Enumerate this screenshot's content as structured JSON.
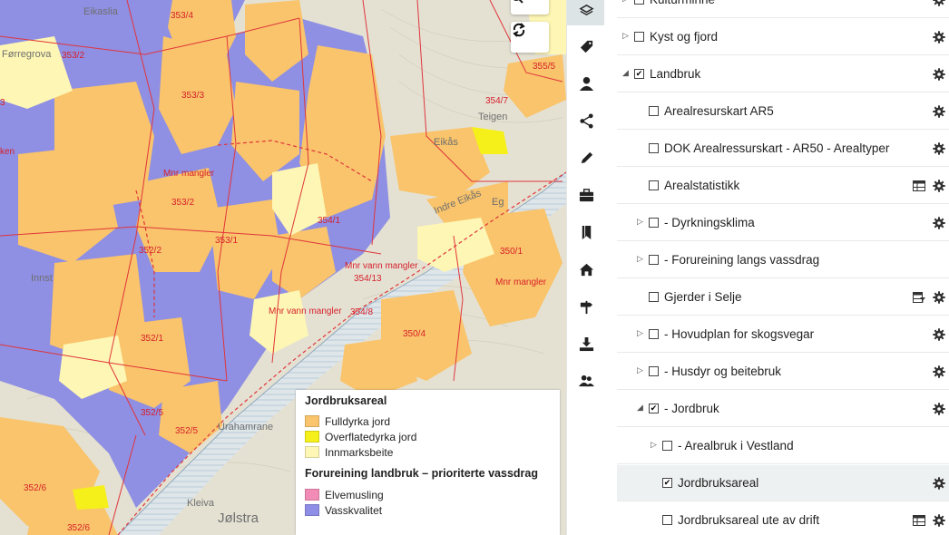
{
  "map": {
    "place_labels": [
      "Eikaslia",
      "Førregrova",
      "Eikås",
      "Teigen",
      "Indre Eikås",
      "Eg",
      "Innst",
      "Urahamrane",
      "Kleiva",
      "Jølstra"
    ],
    "parcel_labels": [
      "353/4",
      "353/2",
      "355/5",
      "354/7",
      "353/3",
      "353/2",
      "354/1",
      "353/1",
      "352/2",
      "350/1",
      "354/13",
      "354/8",
      "350/4",
      "352/1",
      "352/5",
      "352/5",
      "352/6",
      "352/6",
      "3",
      "ken"
    ],
    "mnr_labels": [
      "Mnr mangler",
      "Mnr vann mangler",
      "Mnr mangler",
      "Mnr vann mangler"
    ],
    "legend": {
      "title1": "Jordbruksareal",
      "items1": [
        {
          "label": "Fulldyrka jord",
          "color": "#f9c46b"
        },
        {
          "label": "Overflatedyrka jord",
          "color": "#f6f01a"
        },
        {
          "label": "Innmarksbeite",
          "color": "#fdf6b4"
        }
      ],
      "title2": "Forureining landbruk – prioriterte vassdrag",
      "items2": [
        {
          "label": "Elvemusling",
          "color": "#f28bb5"
        },
        {
          "label": "Vasskvalitet",
          "color": "#8e8ee6"
        }
      ]
    }
  },
  "toolbar": {
    "items": [
      "layers-icon",
      "tag-icon",
      "person-icon",
      "share-icon",
      "pencil-icon",
      "briefcase-icon",
      "bookmark-icon",
      "home-icon",
      "signpost-icon",
      "download-icon",
      "users-icon"
    ]
  },
  "layers": [
    {
      "label": "Kulturminne",
      "checked": false,
      "expander": "closed",
      "level": 0,
      "gear": true,
      "extra": ""
    },
    {
      "label": "Kyst og fjord",
      "checked": false,
      "expander": "closed",
      "level": 0,
      "gear": true,
      "extra": ""
    },
    {
      "label": "Landbruk",
      "checked": true,
      "expander": "open",
      "level": 0,
      "gear": true,
      "extra": ""
    },
    {
      "label": "Arealresurskart AR5",
      "checked": false,
      "expander": "none",
      "level": 1,
      "gear": true,
      "extra": ""
    },
    {
      "label": "DOK Arealressurskart - AR50 - Arealtyper",
      "checked": false,
      "expander": "none",
      "level": 1,
      "gear": true,
      "extra": ""
    },
    {
      "label": "Arealstatistikk",
      "checked": false,
      "expander": "none",
      "level": 1,
      "gear": true,
      "extra": "table"
    },
    {
      "label": "- Dyrkningsklima",
      "checked": false,
      "expander": "closed",
      "level": 1,
      "gear": true,
      "extra": ""
    },
    {
      "label": "- Forureining langs vassdrag",
      "checked": false,
      "expander": "closed",
      "level": 1,
      "gear": false,
      "extra": ""
    },
    {
      "label": "Gjerder i Selje",
      "checked": false,
      "expander": "none",
      "level": 1,
      "gear": true,
      "extra": "filter-table"
    },
    {
      "label": "- Hovudplan for skogsvegar",
      "checked": false,
      "expander": "closed",
      "level": 1,
      "gear": true,
      "extra": ""
    },
    {
      "label": "- Husdyr og beitebruk",
      "checked": false,
      "expander": "closed",
      "level": 1,
      "gear": true,
      "extra": ""
    },
    {
      "label": "- Jordbruk",
      "checked": true,
      "expander": "open",
      "level": 1,
      "gear": true,
      "extra": ""
    },
    {
      "label": "- Arealbruk i Vestland",
      "checked": false,
      "expander": "closed",
      "level": 2,
      "gear": false,
      "extra": ""
    },
    {
      "label": "Jordbruksareal",
      "checked": true,
      "expander": "none",
      "level": 2,
      "gear": true,
      "extra": "",
      "selected": true
    },
    {
      "label": "Jordbruksareal ute av drift",
      "checked": false,
      "expander": "none",
      "level": 2,
      "gear": true,
      "extra": "table"
    }
  ]
}
